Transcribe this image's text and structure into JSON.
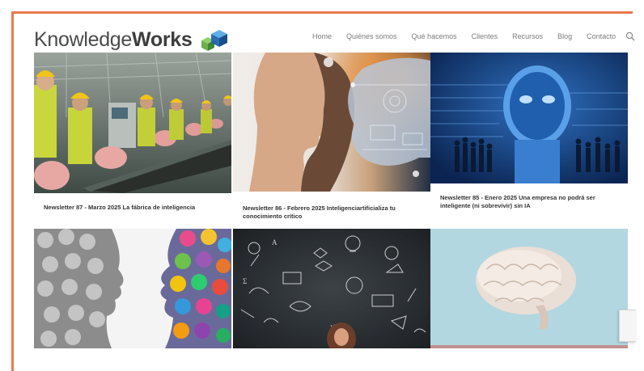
{
  "header": {
    "logo_light": "Knowledge",
    "logo_bold": "Works"
  },
  "nav": {
    "items": [
      "Home",
      "Quiénes somos",
      "Qué hacemos",
      "Clientes",
      "Recursos",
      "Blog",
      "Contacto"
    ]
  },
  "cards": [
    {
      "title": "Newsletter 87 - Marzo 2025 La fábrica de inteligencia"
    },
    {
      "title": "Newsletter 86 - Febrero 2025 Inteligenciartificializa tu conocimiento crítico"
    },
    {
      "title": "Newsletter 85 - Enero 2025 Una empresa no podrá ser inteligente (ni sobrevivir) sin IA"
    },
    {
      "title": ""
    },
    {
      "title": ""
    },
    {
      "title": ""
    }
  ],
  "colors": {
    "frame": "#e8794d",
    "logo_blue": "#2a6fb5",
    "logo_green": "#6ab04c",
    "nav_text": "#7c7c7c"
  }
}
